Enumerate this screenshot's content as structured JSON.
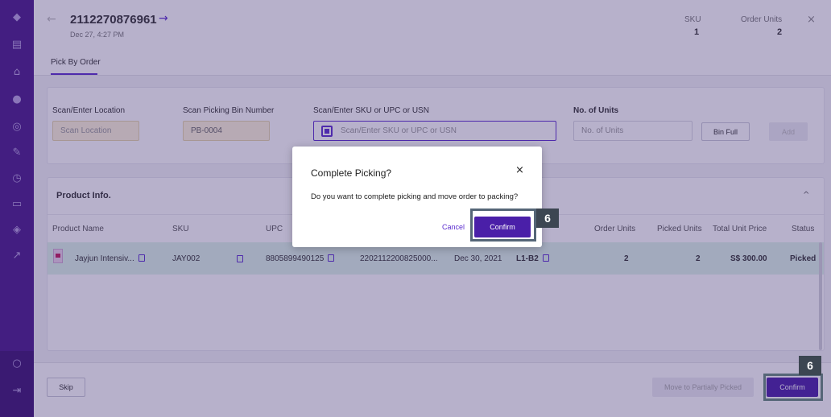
{
  "sidebar": {
    "icons": [
      "logo-icon",
      "dashboard-icon",
      "home-icon",
      "users-icon",
      "orders-icon",
      "edit-icon",
      "clock-icon",
      "truck-icon",
      "layers-icon",
      "external-icon",
      "profile-icon",
      "logout-icon"
    ]
  },
  "header": {
    "order_id": "2112270876961",
    "order_arrow": "→",
    "date": "Dec 27, 4:27 PM",
    "sku_label": "SKU",
    "sku_value": "1",
    "order_units_label": "Order Units",
    "order_units_value": "2",
    "close": "×"
  },
  "tabs": [
    {
      "label": "Pick By Order"
    }
  ],
  "scan": {
    "location_label": "Scan/Enter Location",
    "location_placeholder": "Scan Location",
    "bin_label": "Scan Picking Bin Number",
    "bin_value": "PB-0004",
    "sku_label": "Scan/Enter SKU or UPC or USN",
    "sku_placeholder": "Scan/Enter SKU or UPC or USN",
    "units_label": "No. of Units",
    "units_placeholder": "No. of Units",
    "bin_full_label": "Bin Full",
    "add_label": "Add"
  },
  "product": {
    "title": "Product Info.",
    "collapse": "^",
    "columns": [
      "Product Name",
      "SKU",
      "UPC",
      "Order Units",
      "Picked Units",
      "Total Unit Price",
      "Status"
    ],
    "row": {
      "name": "Jayjun Intensiv...",
      "sku": "JAY002",
      "upc": "8805899490125",
      "usn": "2202112200825000...",
      "expiry": "Dec 30, 2021",
      "location": "L1-B2",
      "order_units": "2",
      "picked_units": "2",
      "total_price": "S$ 300.00",
      "status": "Picked"
    }
  },
  "footer": {
    "skip_label": "Skip",
    "partial_label": "Move to Partially Picked",
    "confirm_label": "Confirm"
  },
  "modal": {
    "title": "Complete Picking?",
    "close": "×",
    "message": "Do you want to complete picking and move order to packing?",
    "cancel_label": "Cancel",
    "confirm_label": "Confirm"
  },
  "annotations": {
    "badge_modal": "6",
    "badge_footer": "6"
  },
  "colors": {
    "accent": "#4a1fa8",
    "sidebar": "#4a1a8c",
    "row_highlight": "#def4ea"
  }
}
